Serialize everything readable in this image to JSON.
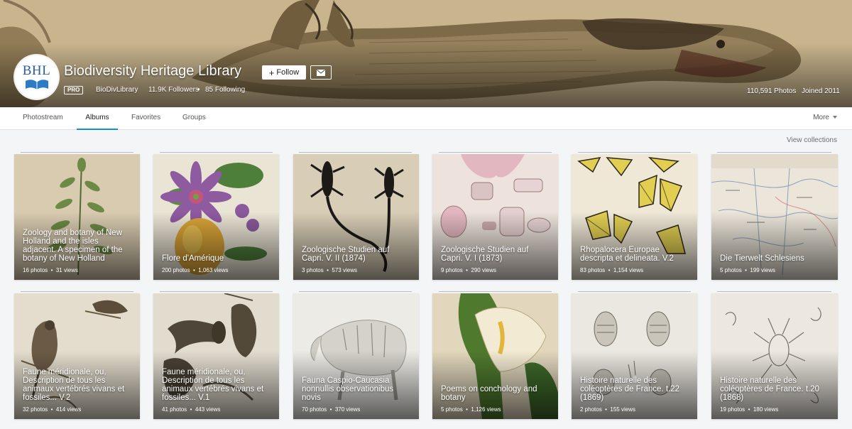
{
  "profile": {
    "logo_text": "BHL",
    "name": "Biodiversity Heritage Library",
    "follow_label": "Follow",
    "pro_badge": "PRO",
    "username": "BioDivLibrary",
    "followers": "11.9K Followers",
    "following": "85 Following",
    "photos": "110,591 Photos",
    "joined": "Joined 2011"
  },
  "nav": {
    "tabs": [
      "Photostream",
      "Albums",
      "Favorites",
      "Groups"
    ],
    "active_tab": "Albums",
    "more_label": "More",
    "accent_color": "#128fdc"
  },
  "view_collections": "View collections",
  "albums": [
    {
      "title": "Zoology and botany of New Holland and the isles adjacent. A specimen of the botany of New Holland",
      "photos": "16 photos",
      "views": "31 views"
    },
    {
      "title": "Flore d'Amérique",
      "photos": "200 photos",
      "views": "1,063 views"
    },
    {
      "title": "Zoologische Studien auf Capri. V. II (1874)",
      "photos": "3 photos",
      "views": "573 views"
    },
    {
      "title": "Zoologische Studien auf Capri. V. I (1873)",
      "photos": "9 photos",
      "views": "290 views"
    },
    {
      "title": "Rhopalocera Europae descripta et delineata. V.2",
      "photos": "83 photos",
      "views": "1,154 views"
    },
    {
      "title": "Die Tierwelt Schlesiens",
      "photos": "5 photos",
      "views": "199 views"
    },
    {
      "title": "Faune méridionale, ou, Description de tous les animaux vertébrés vivans et fossiles... V.2",
      "photos": "32 photos",
      "views": "414 views"
    },
    {
      "title": "Faune méridionale, ou, Description de tous les animaux vertébrés vivans et fossiles... V.1",
      "photos": "41 photos",
      "views": "443 views"
    },
    {
      "title": "Fauna Caspio-Caucasia nonnullis observationibus novis",
      "photos": "70 photos",
      "views": "370 views"
    },
    {
      "title": "Poems on conchology and botany",
      "photos": "5 photos",
      "views": "1,126 views"
    },
    {
      "title": "Histoire naturelle des coléoptères de France. t.22 (1869)",
      "photos": "2 photos",
      "views": "155 views"
    },
    {
      "title": "Histoire naturelle des coléoptères de France. t.20 (1868)",
      "photos": "19 photos",
      "views": "180 views"
    }
  ]
}
